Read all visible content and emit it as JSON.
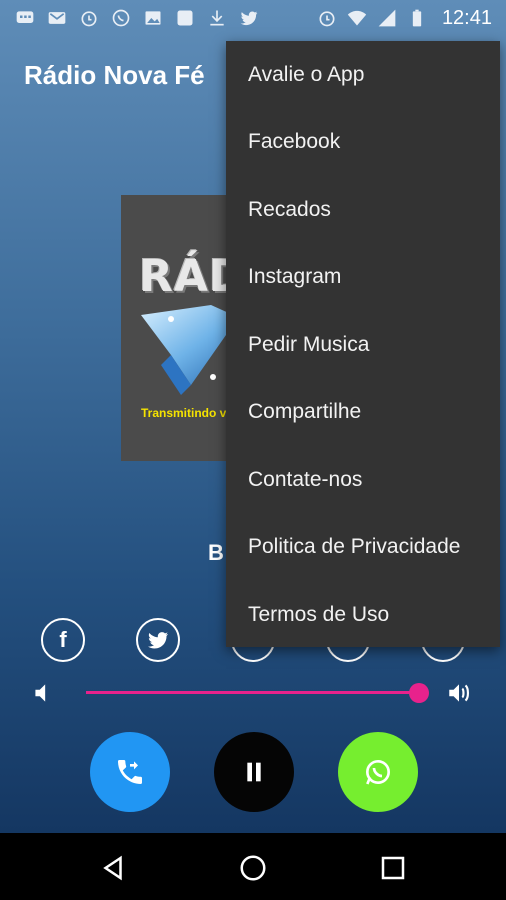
{
  "status_bar": {
    "time": "12:41"
  },
  "app": {
    "title": "Rádio Nova Fé"
  },
  "album": {
    "logo_text": "RÁD",
    "tagline": "Transmitindo v"
  },
  "now_playing": {
    "title": "B"
  },
  "volume": {
    "level": 0.99
  },
  "colors": {
    "accent": "#e8228c",
    "call": "#2196f3",
    "whatsapp": "#76ee2f",
    "play": "#050505",
    "menu_bg": "#333333"
  },
  "menu": {
    "items": [
      {
        "label": "Avalie o App"
      },
      {
        "label": "Facebook"
      },
      {
        "label": "Recados"
      },
      {
        "label": "Instagram"
      },
      {
        "label": "Pedir Musica"
      },
      {
        "label": "Compartilhe"
      },
      {
        "label": "Contate-nos"
      },
      {
        "label": "Politica de Privacidade"
      },
      {
        "label": "Termos de Uso"
      }
    ]
  },
  "social": {
    "facebook_glyph": "f"
  },
  "icons": [
    "message-icon",
    "gmail-icon",
    "alarm-icon",
    "whatsapp-icon",
    "image-icon",
    "app-icon",
    "download-icon",
    "twitter-icon",
    "alarm-icon",
    "wifi-icon",
    "signal-icon",
    "battery-icon"
  ]
}
